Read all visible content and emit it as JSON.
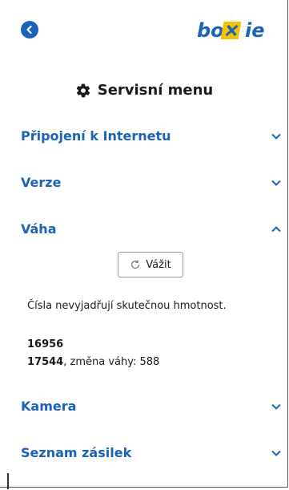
{
  "header": {
    "back_icon": "chevron-left-icon",
    "logo_text": "boxie"
  },
  "title": {
    "icon": "gear-icon",
    "text": "Servisní menu"
  },
  "sections": [
    {
      "label": "Připojení k Internetu",
      "expanded": false
    },
    {
      "label": "Verze",
      "expanded": false
    },
    {
      "label": "Váha",
      "expanded": true
    },
    {
      "label": "Kamera",
      "expanded": false
    },
    {
      "label": "Seznam zásilek",
      "expanded": false
    }
  ],
  "weight": {
    "button_label": "Vážit",
    "note": "Čísla nevyjadřují skutečnou hmotnost.",
    "reading1": "16956",
    "reading2_value": "17544",
    "reading2_suffix": ", změna váhy: 588"
  },
  "colors": {
    "accent": "#1a63b8",
    "logo_yellow": "#f5c400"
  }
}
